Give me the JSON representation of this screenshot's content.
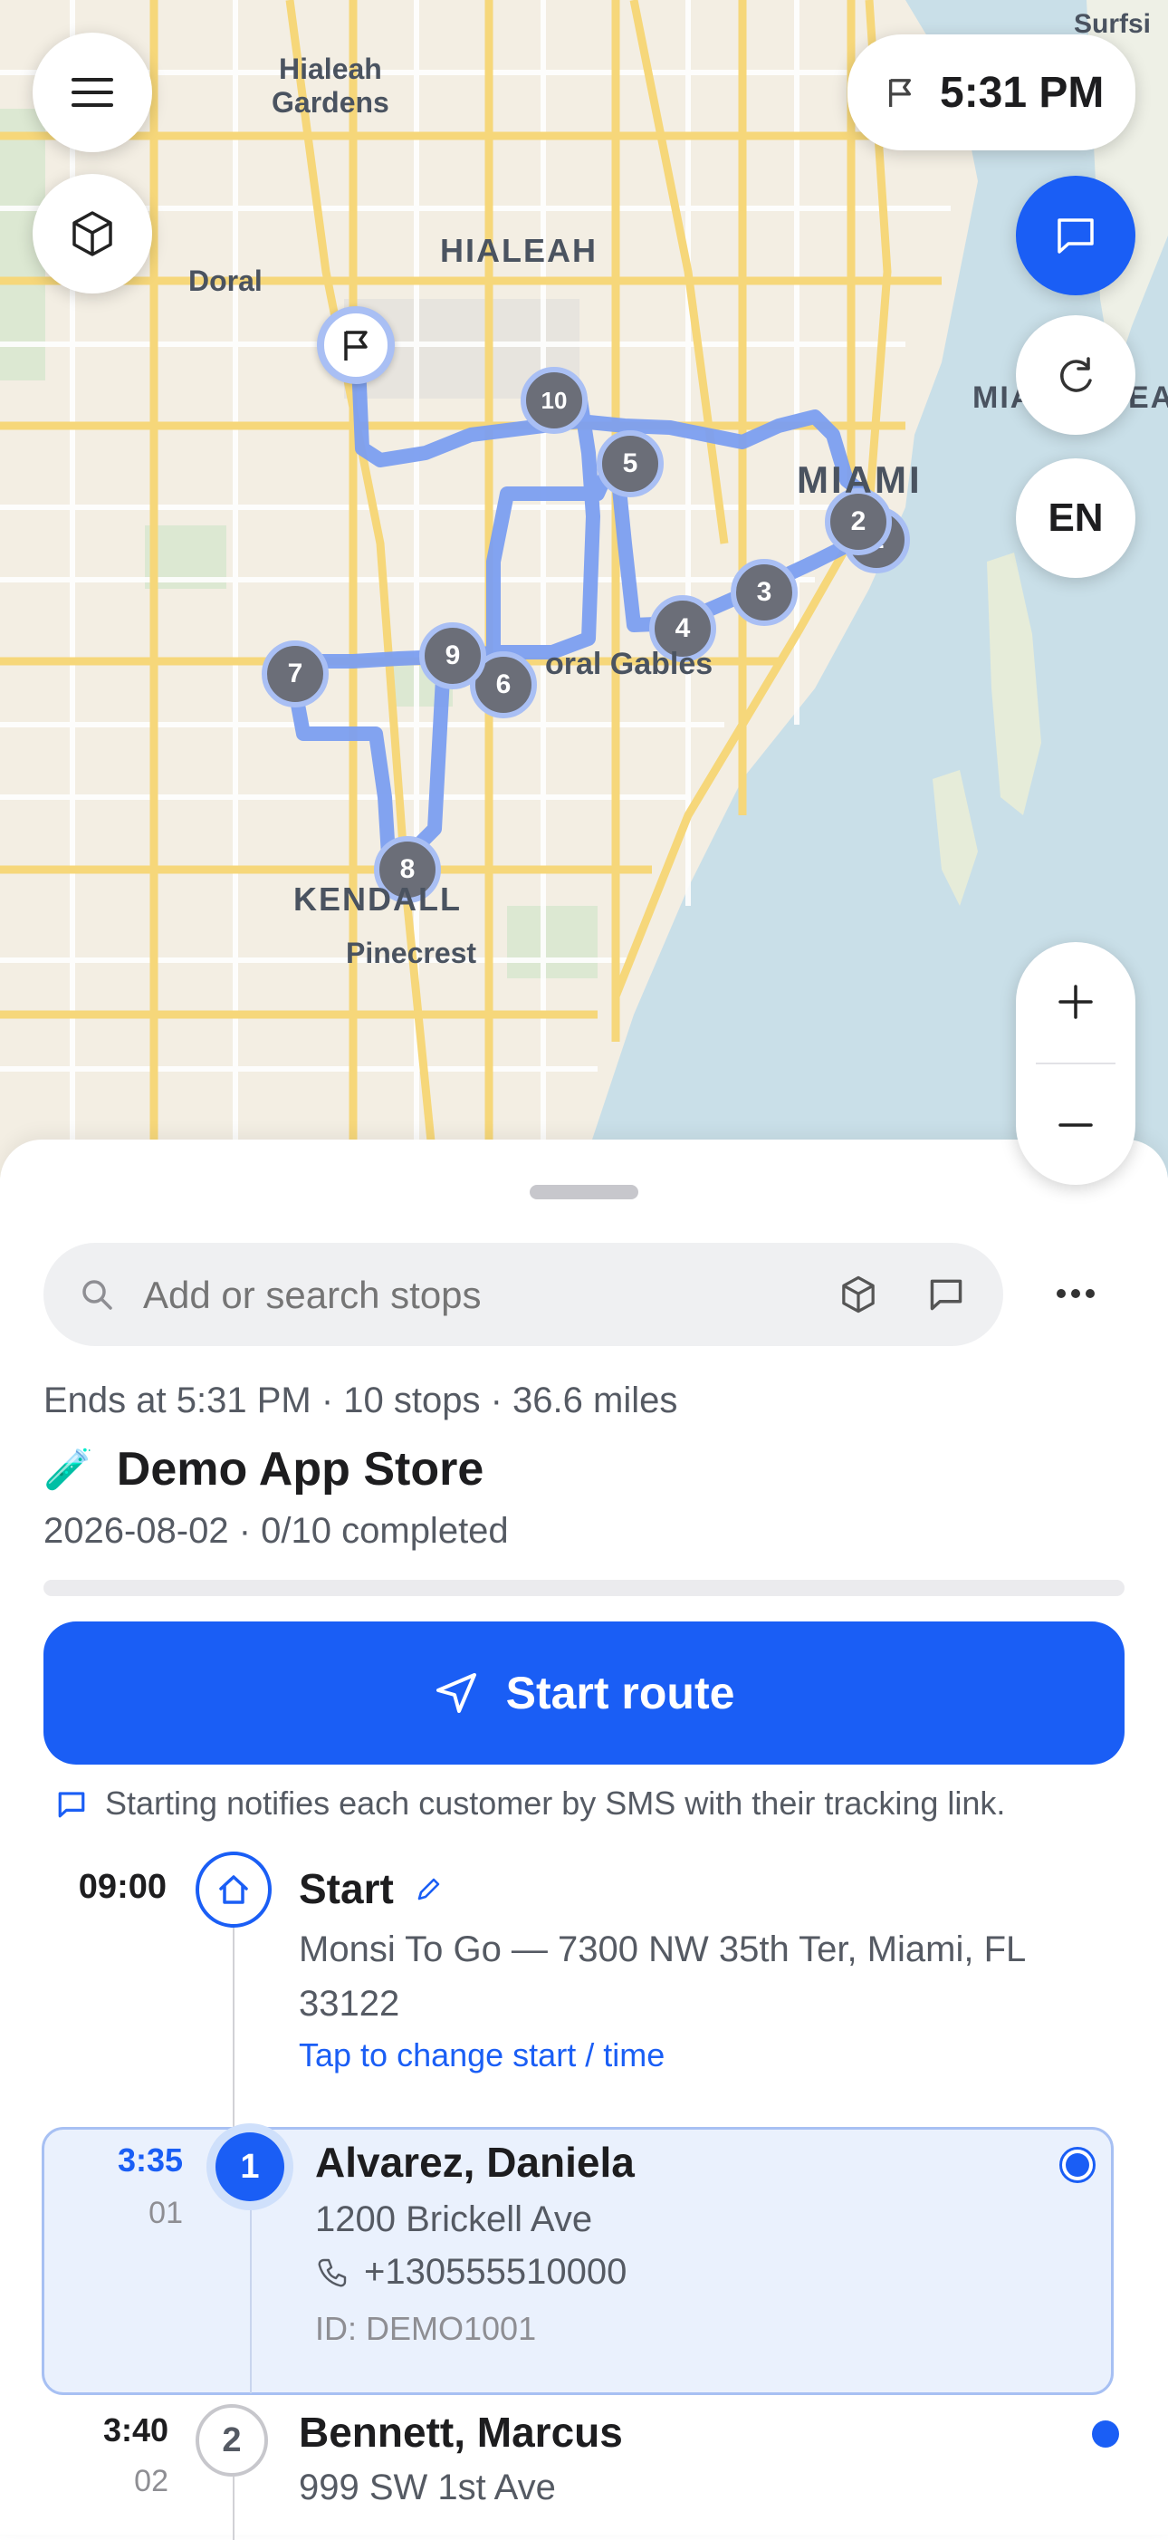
{
  "map": {
    "labels": {
      "hialeah_gardens": "Hialeah\nGardens",
      "hialeah": "HIALEAH",
      "doral": "Doral",
      "miami": "MIAMI",
      "miami_beach_partial": "MIA",
      "miami_beach_partial2": "EA",
      "coral_gables": "oral Gables",
      "kendall": "KENDALL",
      "pinecrest": "Pinecrest",
      "surfside_partial": "Surfsi"
    },
    "markers": [
      "1",
      "2",
      "3",
      "4",
      "5",
      "6",
      "7",
      "8",
      "9",
      "10"
    ],
    "route_color": "#7b9ef0",
    "marker_color": "#6b6e78",
    "water_color": "#c9dfe8"
  },
  "top_bar": {
    "end_time": "5:31 PM",
    "language": "EN",
    "menu_icon": "hamburger-icon",
    "cube_icon": "cube-icon",
    "flag_icon": "flag-icon",
    "chat_icon": "chat-icon",
    "refresh_icon": "refresh-icon"
  },
  "zoom": {
    "in_icon": "plus-icon",
    "out_icon": "minus-icon"
  },
  "sheet": {
    "search_placeholder": "Add or search stops",
    "summary": "Ends at 5:31 PM · 10 stops · 36.6 miles",
    "route_emoji": "🧪",
    "route_name": "Demo App Store",
    "route_meta": "2026-08-02 · 0/10 completed",
    "progress": 0,
    "start_button": "Start route",
    "sms_note": "Starting notifies each customer by SMS with their tracking link.",
    "accent": "#1a5ef5"
  },
  "start": {
    "time": "09:00",
    "title": "Start",
    "address": "Monsi To Go — 7300 NW 35th Ter, Miami, FL 33122",
    "change_link": "Tap to change start / time"
  },
  "stops": [
    {
      "time": "3:35",
      "seq": "01",
      "number": "1",
      "name": "Alvarez, Daniela",
      "address": "1200 Brickell Ave",
      "phone": "+130555510000",
      "id": "ID: DEMO1001"
    },
    {
      "time": "3:40",
      "seq": "02",
      "number": "2",
      "name": "Bennett, Marcus",
      "address": "999 SW 1st Ave"
    }
  ]
}
